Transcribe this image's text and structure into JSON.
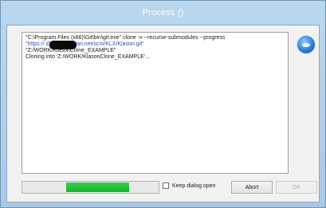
{
  "window": {
    "title": "Process ()"
  },
  "log": {
    "lines": [
      "\"C:\\Program Files (x86)\\Git\\bin\\git.exe\" clone -v --recurse-submodules --progress",
      "\"https://          @stash.devlan.net/scm/KLX/Klason.git\"",
      "\"Z:/WORK/KlasonClone_EXAMPLE\"",
      "Cloning into 'Z:/WORK/KlasonClone_EXAMPLE'..."
    ]
  },
  "progress": {
    "start_fraction": 0.32,
    "value_fraction": 0.46,
    "color": "#22c13c"
  },
  "options": {
    "keep_dialog_open_label": "Keep dialog open",
    "keep_dialog_open_checked": false
  },
  "buttons": {
    "abort_label": "Abort",
    "ok_label": "OK"
  },
  "icons": {
    "status_icon": "info-globe-icon"
  }
}
